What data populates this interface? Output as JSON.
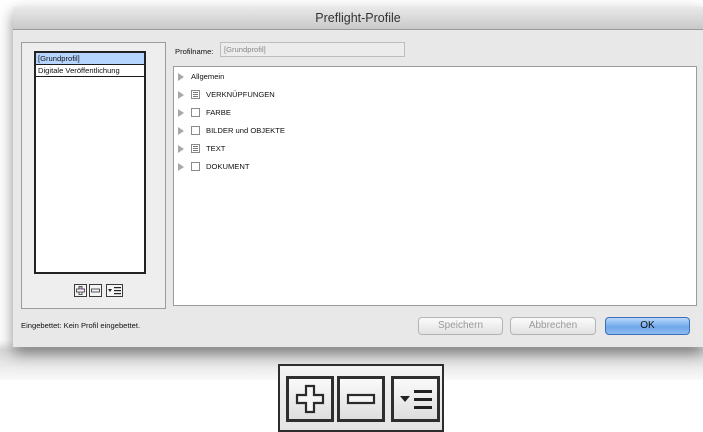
{
  "window": {
    "title": "Preflight-Profile"
  },
  "profiles": {
    "items": [
      "[Grundprofil]",
      "Digitale Veröffentlichung"
    ],
    "selected_index": 0
  },
  "list_buttons": {
    "new_icon": "plus-icon",
    "delete_icon": "minus-icon",
    "menu_icon": "menu-icon"
  },
  "profile_name": {
    "label": "Profilname:",
    "value": "[Grundprofil]"
  },
  "tree": {
    "rows": [
      {
        "label": "Allgemein",
        "checkbox": "none"
      },
      {
        "label": "VERKNÜPFUNGEN",
        "checkbox": "mixed"
      },
      {
        "label": "FARBE",
        "checkbox": "unchecked"
      },
      {
        "label": "BILDER und OBJEKTE",
        "checkbox": "unchecked"
      },
      {
        "label": "TEXT",
        "checkbox": "mixed"
      },
      {
        "label": "DOKUMENT",
        "checkbox": "unchecked"
      }
    ]
  },
  "footer": {
    "embedded_text": "Eingebettet: Kein Profil eingebettet.",
    "save_label": "Speichern",
    "cancel_label": "Abbrechen",
    "ok_label": "OK"
  },
  "colors": {
    "selection": "#b5d5ff",
    "ok_button": "#6fa7ea"
  }
}
